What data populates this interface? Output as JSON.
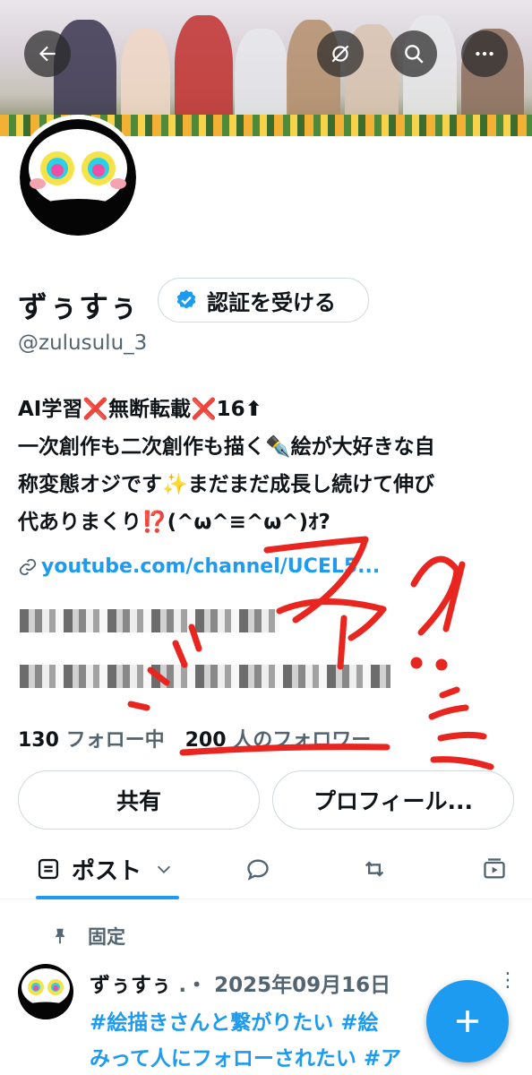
{
  "profile": {
    "name": "ずぅすぅ",
    "verify_label": "認証を受ける",
    "handle": "@zulusulu_3",
    "bio_lines": [
      "AI学習❌無断転載❌16⬆",
      "一次創作も二次創作も描く✒️絵が大好きな自",
      "称変態オジです✨まだまだ成長し続けて伸び",
      "代ありまくり⁉️(^ω^≡^ω^)ｵ?"
    ],
    "link": "youtube.com/channel/UCEL5...",
    "following_count": "130",
    "following_label": "フォロー中",
    "followers_count": "200",
    "followers_label": "人のフォロワー"
  },
  "actions": {
    "share_label": "共有",
    "profile_label": "プロフィール..."
  },
  "tabs": {
    "posts_label": "ポスト"
  },
  "post": {
    "pinned_label": "固定",
    "author": "ずぅすぅ",
    "separator": ".・",
    "date": "2025年09月16日",
    "hashtag_line1": "#絵描きさんと繋がりたい #絵",
    "hashtag_line2": "みって人にフォローされたい #ア"
  },
  "annotation": {
    "text": "ファ?!",
    "color": "#e8251f"
  },
  "colors": {
    "accent": "#1d9bf0",
    "text": "#0f1419",
    "muted": "#536471"
  }
}
